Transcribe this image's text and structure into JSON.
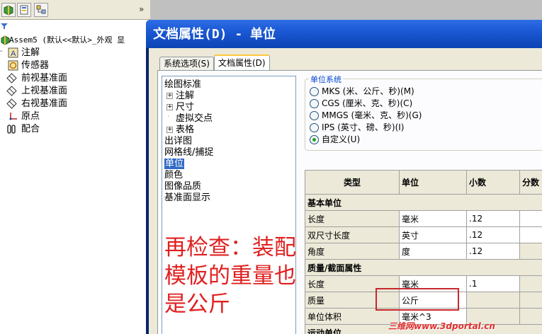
{
  "feature_manager": {
    "root": "Assem5  (默认<<默认>_外观 显",
    "items": [
      {
        "label": "注解",
        "icon": "annotations-icon"
      },
      {
        "label": "传感器",
        "icon": "sensor-icon"
      },
      {
        "label": "前视基准面",
        "icon": "plane-icon"
      },
      {
        "label": "上视基准面",
        "icon": "plane-icon"
      },
      {
        "label": "右视基准面",
        "icon": "plane-icon"
      },
      {
        "label": "原点",
        "icon": "origin-icon"
      },
      {
        "label": "配合",
        "icon": "mates-icon"
      }
    ],
    "chevron": "»"
  },
  "dialog": {
    "title": "文档属性(D)  -  单位",
    "tabs": {
      "system": "系统选项(S)",
      "document": "文档属性(D)"
    }
  },
  "options_tree": {
    "items": [
      {
        "label": "绘图标准",
        "indent": 0
      },
      {
        "label": "注解",
        "indent": 1,
        "expandable": true
      },
      {
        "label": "尺寸",
        "indent": 1,
        "expandable": true
      },
      {
        "label": "虚拟交点",
        "indent": 1
      },
      {
        "label": "表格",
        "indent": 1,
        "expandable": true
      },
      {
        "label": "出详图",
        "indent": 0
      },
      {
        "label": "网格线/捕捉",
        "indent": 0
      },
      {
        "label": "单位",
        "indent": 0,
        "selected": true
      },
      {
        "label": "颜色",
        "indent": 0
      },
      {
        "label": "图像品质",
        "indent": 0
      },
      {
        "label": "基准面显示",
        "indent": 0
      }
    ],
    "annotation": "再检查：装配模板的重量也是公斤"
  },
  "unit_system": {
    "title": "单位系统",
    "options": [
      {
        "label": "MKS (米、公斤、秒)(M)",
        "checked": false
      },
      {
        "label": "CGS (厘米、克、秒)(C)",
        "checked": false
      },
      {
        "label": "MMGS (毫米、克、秒)(G)",
        "checked": false
      },
      {
        "label": "IPS (英寸、磅、秒)(I)",
        "checked": false
      },
      {
        "label": "自定义(U)",
        "checked": true
      }
    ]
  },
  "units_table": {
    "headers": [
      "类型",
      "单位",
      "小数",
      "分数"
    ],
    "rows": [
      {
        "section": "基本单位"
      },
      {
        "type": "长度",
        "unit": "毫米",
        "decimals": ".12"
      },
      {
        "type": "双尺寸长度",
        "unit": "英寸",
        "decimals": ".12"
      },
      {
        "type": "角度",
        "unit": "度",
        "decimals": ".12"
      },
      {
        "section": "质量/截面属性"
      },
      {
        "type": "长度",
        "unit": "毫米",
        "decimals": ".1"
      },
      {
        "type": "质量",
        "unit": "公斤",
        "decimals": ""
      },
      {
        "type": "单位体积",
        "unit": "毫米^3",
        "decimals": ""
      },
      {
        "section": "运动单位"
      }
    ]
  },
  "watermark": "三维网www.3dportal.cn",
  "colors": {
    "title_bar": "#1b58d4",
    "selection": "#316ac5",
    "annotation": "#e02020",
    "highlight_box": "#c8282c"
  }
}
